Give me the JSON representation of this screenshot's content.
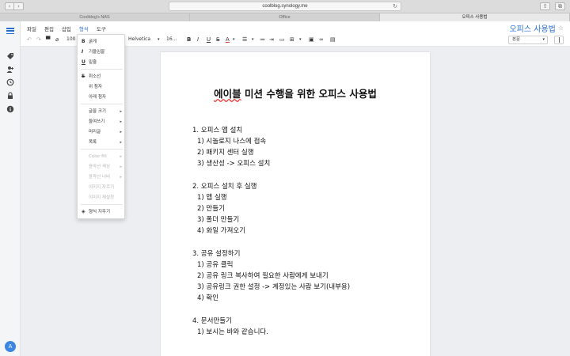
{
  "browser": {
    "url": "coolblog.synology.me",
    "tabs": [
      "Coolblog's NAS",
      "Office",
      "오피스 사용법"
    ]
  },
  "menu": {
    "items": [
      "파일",
      "편집",
      "삽입",
      "형식",
      "도구"
    ],
    "active_index": 3
  },
  "document_title": "오피스 사용법",
  "toolbar": {
    "zoom": "100",
    "font": "Helvetica",
    "size": "16...",
    "bold": "B",
    "italic": "I",
    "underline": "U",
    "strike": "S",
    "font_color": "A",
    "paragraph_style": "본문"
  },
  "format_menu": {
    "items": [
      {
        "icon": "B",
        "label": "굵게",
        "enabled": true,
        "submenu": false
      },
      {
        "icon": "I",
        "label": "기울임꼴",
        "enabled": true,
        "submenu": false
      },
      {
        "icon": "U",
        "label": "밑줄",
        "enabled": true,
        "submenu": false
      },
      {
        "icon": "S",
        "label": "취소선",
        "enabled": true,
        "submenu": false
      },
      {
        "icon": "",
        "label": "위 첨자",
        "enabled": true,
        "submenu": false
      },
      {
        "icon": "",
        "label": "아래 첨자",
        "enabled": true,
        "submenu": false
      },
      {
        "icon": "",
        "label": "글꼴 크기",
        "enabled": true,
        "submenu": true
      },
      {
        "icon": "",
        "label": "들여쓰기",
        "enabled": true,
        "submenu": true
      },
      {
        "icon": "",
        "label": "머리글",
        "enabled": true,
        "submenu": true
      },
      {
        "icon": "",
        "label": "목록",
        "enabled": true,
        "submenu": true
      },
      {
        "icon": "",
        "label": "Color fill",
        "enabled": false,
        "submenu": true
      },
      {
        "icon": "",
        "label": "윤곽선 색상",
        "enabled": false,
        "submenu": true
      },
      {
        "icon": "",
        "label": "윤곽선 너비",
        "enabled": false,
        "submenu": true
      },
      {
        "icon": "",
        "label": "이미지 자르기",
        "enabled": false,
        "submenu": false
      },
      {
        "icon": "",
        "label": "이미지 재설정",
        "enabled": false,
        "submenu": false
      },
      {
        "icon": "eraser",
        "label": "형식 지우기",
        "enabled": true,
        "submenu": false
      }
    ]
  },
  "document": {
    "heading": "에이블 미션 수행을 위한 오피스 사용법",
    "heading_misspelled": "에이블",
    "heading_rest": " 미션 수행을 위한 오피스 사용법",
    "lines": [
      {
        "text": "1. 오피스 앱 설치",
        "level": 0
      },
      {
        "text": "1) 시놀로지 나스에 접속",
        "level": 1
      },
      {
        "text": "2) 패키지 센터 실행",
        "level": 1
      },
      {
        "text": "3) 생산성 -> 오피스 설치",
        "level": 1
      },
      {
        "text": "2. 오피스 설치 후 실행",
        "level": 0
      },
      {
        "text": "1) 앱 실행",
        "level": 1
      },
      {
        "text": "2) 만들기",
        "level": 1
      },
      {
        "text": "3) 폴더 만들기",
        "level": 1
      },
      {
        "text": "4) 화일 가져오기",
        "level": 1
      },
      {
        "text": "3. 공유 설정하기",
        "level": 0
      },
      {
        "text": "1) 공유 클릭",
        "level": 1
      },
      {
        "text": "2) 공유 링크 복사하여 필요한 사람에게 보내기",
        "level": 1
      },
      {
        "text": "3) 공유링크 권한 설정 -> 계정있는 사람 보기(내부용)",
        "level": 1
      },
      {
        "text": "4) 확인",
        "level": 1
      },
      {
        "text": "4. 문서만들기",
        "level": 0
      },
      {
        "text": "1) 보시는 바와 같습니다.",
        "level": 1
      }
    ]
  },
  "user": {
    "avatar_initial": "A"
  },
  "colors": {
    "accent": "#2b6ed2",
    "avatar": "#3b86e0",
    "misspell": "#e33333"
  }
}
